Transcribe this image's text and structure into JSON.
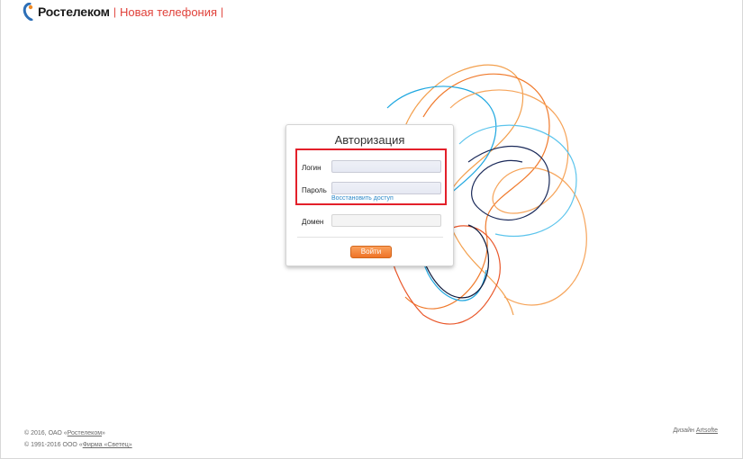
{
  "header": {
    "brand": "Ростелеком",
    "separator": "|",
    "product": "Новая телефония",
    "separator_end": "|"
  },
  "auth": {
    "title": "Авторизация",
    "login_label": "Логин",
    "login_value": "",
    "password_label": "Пароль",
    "password_value": "",
    "restore_link": "Восстановить доступ",
    "domain_label": "Домен",
    "domain_value": "",
    "submit_label": "Войти"
  },
  "footer": {
    "line1_prefix": "© 2016, ОАО «",
    "line1_link": "Ростелеком",
    "line1_suffix": "»",
    "line2_prefix": "© 1991-2016 ООО «",
    "line2_link": "Фирма «Светец»",
    "design_prefix": "Дизайн ",
    "design_link": "Artsofte"
  },
  "colors": {
    "brand_red": "#e0413a",
    "highlight": "#e3202a",
    "button_orange": "#ef7327",
    "link_blue": "#2a87c8"
  },
  "icons": {
    "logo": "rostelecom-logo-icon"
  }
}
